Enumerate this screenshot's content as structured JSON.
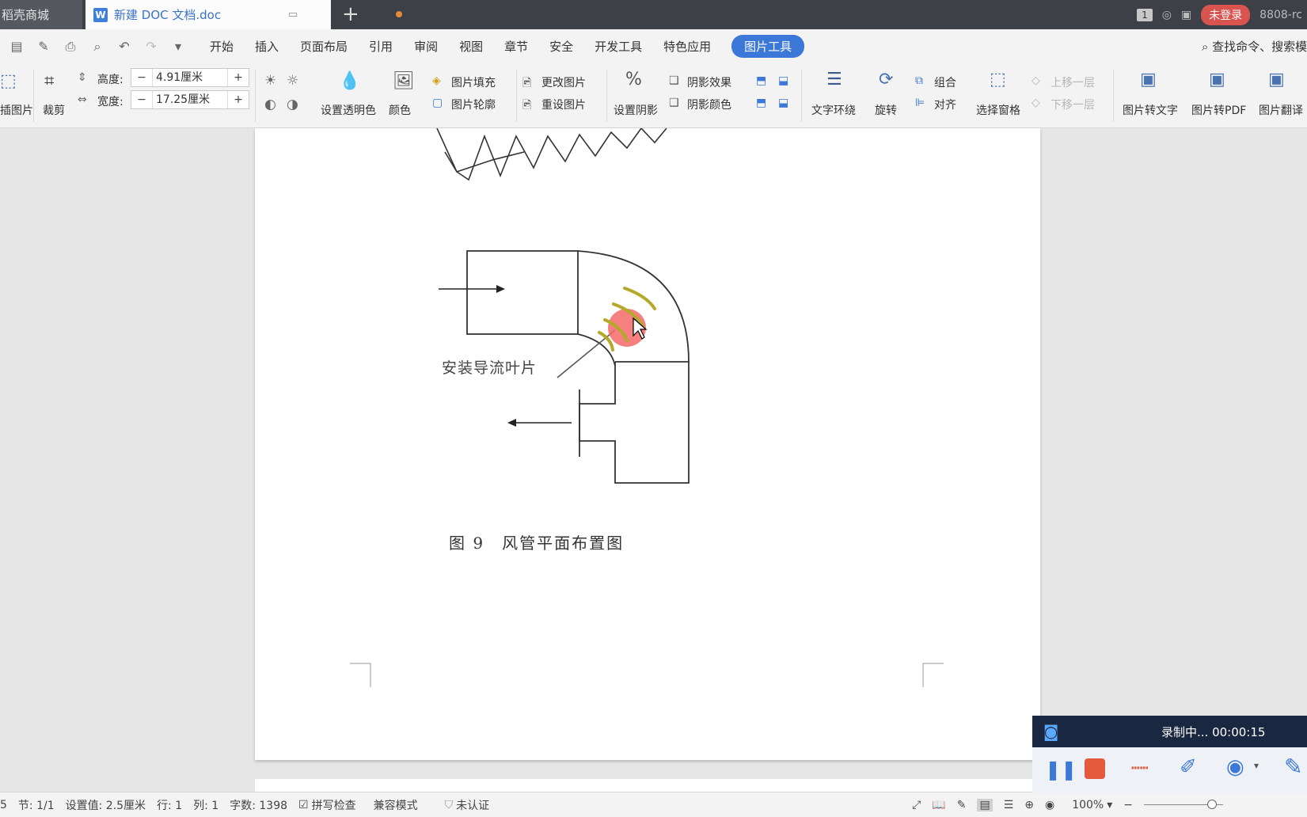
{
  "tabs": {
    "tab1_label": "稻壳商城",
    "tab2_label": "新建 DOC 文档.doc",
    "new_tab": "+",
    "badge": "1",
    "login": "未登录",
    "user": "8808-rc"
  },
  "menu": {
    "items": [
      "开始",
      "插入",
      "页面布局",
      "引用",
      "审阅",
      "视图",
      "章节",
      "安全",
      "开发工具",
      "特色应用"
    ],
    "active": "图片工具",
    "search": "查找命令、搜索模"
  },
  "ribbon": {
    "insert_pic": "插图片",
    "crop": "裁剪",
    "height_label": "高度:",
    "height_value": "4.91厘米",
    "width_label": "宽度:",
    "width_value": "17.25厘米",
    "minus": "−",
    "plus": "+",
    "transparent": "设置透明色",
    "color": "颜色",
    "fill": "图片填充",
    "outline": "图片轮廓",
    "change": "更改图片",
    "reset": "重设图片",
    "shadow": "设置阴影",
    "shadow_effect": "阴影效果",
    "shadow_color": "阴影颜色",
    "wrap": "文字环绕",
    "rotate": "旋转",
    "group": "组合",
    "align": "对齐",
    "select_pane": "选择窗格",
    "bring_forward": "上移一层",
    "send_backward": "下移一层",
    "to_text": "图片转文字",
    "to_pdf": "图片转PDF",
    "translate": "图片翻译"
  },
  "document": {
    "annotation": "安装导流叶片",
    "caption": "图 9　风管平面布置图"
  },
  "status": {
    "page": "5",
    "section": "节: 1/1",
    "setting": "设置值: 2.5厘米",
    "row": "行: 1",
    "col": "列: 1",
    "words": "字数: 1398",
    "spell": "拼写检查",
    "compat": "兼容模式",
    "cert": "未认证",
    "zoom": "100%"
  },
  "recorder": {
    "status": "录制中... 00:00:15"
  },
  "colors": {
    "accent": "#3c78d8",
    "login": "#d9534f",
    "tabbar": "#3d4046",
    "vanes": "#b5a92a",
    "cursor_highlight": "#f46a6a"
  }
}
